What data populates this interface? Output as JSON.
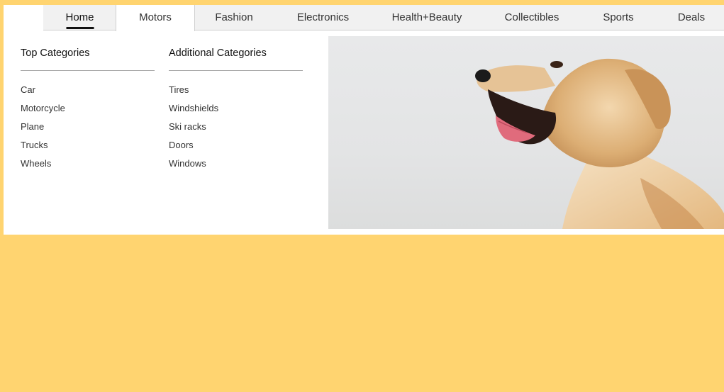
{
  "nav": {
    "items": [
      {
        "label": "Home"
      },
      {
        "label": "Motors"
      },
      {
        "label": "Fashion"
      },
      {
        "label": "Electronics"
      },
      {
        "label": "Health+Beauty"
      },
      {
        "label": "Collectibles"
      },
      {
        "label": "Sports"
      },
      {
        "label": "Deals"
      }
    ],
    "current": "Home",
    "open_menu": "Motors"
  },
  "dropdown": {
    "top_categories": {
      "title": "Top Categories",
      "items": [
        "Car",
        "Motorcycle",
        "Plane",
        "Trucks",
        "Wheels"
      ]
    },
    "additional_categories": {
      "title": "Additional Categories",
      "items": [
        "Tires",
        "Windshields",
        "Ski racks",
        "Doors",
        "Windows"
      ]
    },
    "hero_image": "golden-retriever-yawning"
  },
  "colors": {
    "page_background": "#ffd470",
    "nav_background": "#f1f1f1",
    "panel_background": "#ffffff",
    "active_underline": "#111111",
    "text": "#333333"
  }
}
